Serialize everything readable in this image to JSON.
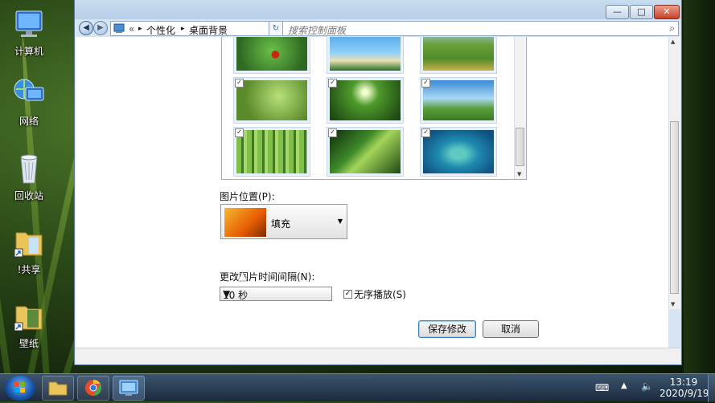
{
  "desktop": {
    "icons": [
      {
        "label": "计算机",
        "icon": "computer-icon"
      },
      {
        "label": "网络",
        "icon": "network-icon"
      },
      {
        "label": "回收站",
        "icon": "recycle-bin-icon"
      },
      {
        "label": "!共享",
        "icon": "shared-folder-icon"
      },
      {
        "label": "壁纸",
        "icon": "wallpaper-folder-icon"
      }
    ]
  },
  "window": {
    "controls": {
      "minimize": "—",
      "maximize": "□",
      "close": "✕"
    },
    "address": {
      "prefix": "«",
      "crumb1": "个性化",
      "crumb2": "桌面背景"
    },
    "search": {
      "placeholder": "搜索控制面板"
    }
  },
  "wallpapers": [
    {
      "name": "ladybug",
      "checked": false
    },
    {
      "name": "palm-beach",
      "checked": false
    },
    {
      "name": "field-road",
      "checked": false
    },
    {
      "name": "sprout",
      "checked": true
    },
    {
      "name": "forest-sun",
      "checked": true
    },
    {
      "name": "meadow-sky",
      "checked": true
    },
    {
      "name": "bamboo",
      "checked": true
    },
    {
      "name": "leaf-drops",
      "checked": true
    },
    {
      "name": "island",
      "checked": true
    }
  ],
  "position": {
    "label": "图片位置(P):",
    "value": "填充"
  },
  "interval": {
    "label": "更改图片时间间隔(N):",
    "value": "10 秒"
  },
  "shuffle": {
    "label": "无序播放(S)",
    "checked": true
  },
  "buttons": {
    "save": "保存修改",
    "cancel": "取消"
  },
  "taskbar": {
    "time": "13:19",
    "date": "2020/9/19"
  },
  "colors": {
    "accent": "#3c7fb1",
    "selection": "#cde8ff"
  }
}
